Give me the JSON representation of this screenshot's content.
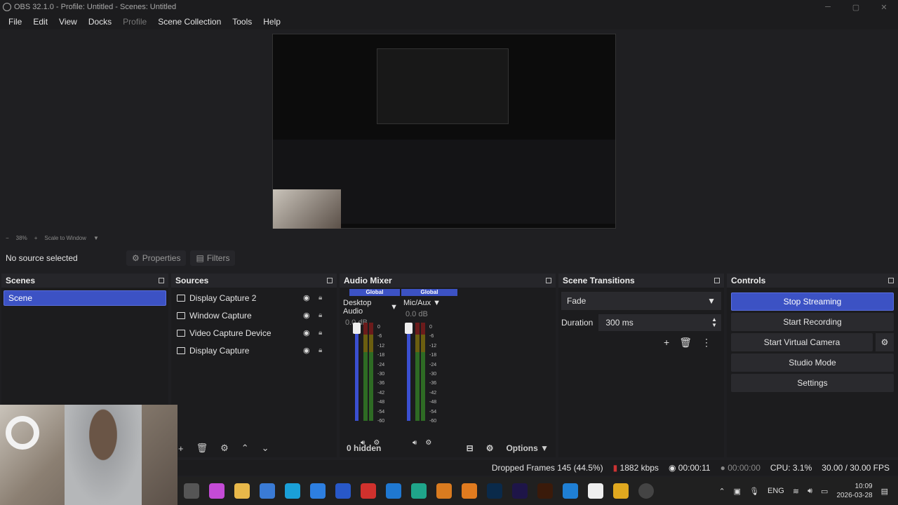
{
  "window": {
    "title": "OBS 32.1.0 - Profile: Untitled - Scenes: Untitled"
  },
  "menu": [
    "File",
    "Edit",
    "View",
    "Docks",
    "Profile",
    "Scene Collection",
    "Tools",
    "Help"
  ],
  "zoom": {
    "percent": "38%",
    "scale_mode": "Scale to Window"
  },
  "context": {
    "no_source": "No source selected",
    "properties": "Properties",
    "filters": "Filters"
  },
  "scenes": {
    "title": "Scenes",
    "items": [
      "Scene"
    ]
  },
  "sources": {
    "title": "Sources",
    "items": [
      "Display Capture 2",
      "Window Capture",
      "Video Capture Device",
      "Display Capture"
    ]
  },
  "mixer": {
    "title": "Audio Mixer",
    "global": "Global",
    "channels": [
      {
        "name": "Desktop Audio",
        "db": "0.0 dB"
      },
      {
        "name": "Mic/Aux",
        "db": "0.0 dB"
      }
    ],
    "scale": [
      "0",
      "-6",
      "-12",
      "-18",
      "-24",
      "-30",
      "-36",
      "-42",
      "-48",
      "-54",
      "-60"
    ],
    "hidden": "0 hidden",
    "options": "Options"
  },
  "transitions": {
    "title": "Scene Transitions",
    "selected": "Fade",
    "duration_label": "Duration",
    "duration": "300 ms"
  },
  "controls": {
    "title": "Controls",
    "stop_streaming": "Stop Streaming",
    "start_recording": "Start Recording",
    "start_virtual_camera": "Start Virtual Camera",
    "studio_mode": "Studio Mode",
    "settings": "Settings"
  },
  "status": {
    "dropped": "Dropped Frames 145 (44.5%)",
    "bitrate": "1882 kbps",
    "stream_time": "00:00:11",
    "rec_time": "00:00:00",
    "cpu": "CPU: 3.1%",
    "fps": "30.00 / 30.00 FPS"
  },
  "tray": {
    "lang": "ENG",
    "time": "10:09",
    "date": "2026-03-28"
  },
  "colors": {
    "accent": "#3c52c4",
    "panel": "#1c1c1e",
    "bg": "#1f1f22"
  }
}
